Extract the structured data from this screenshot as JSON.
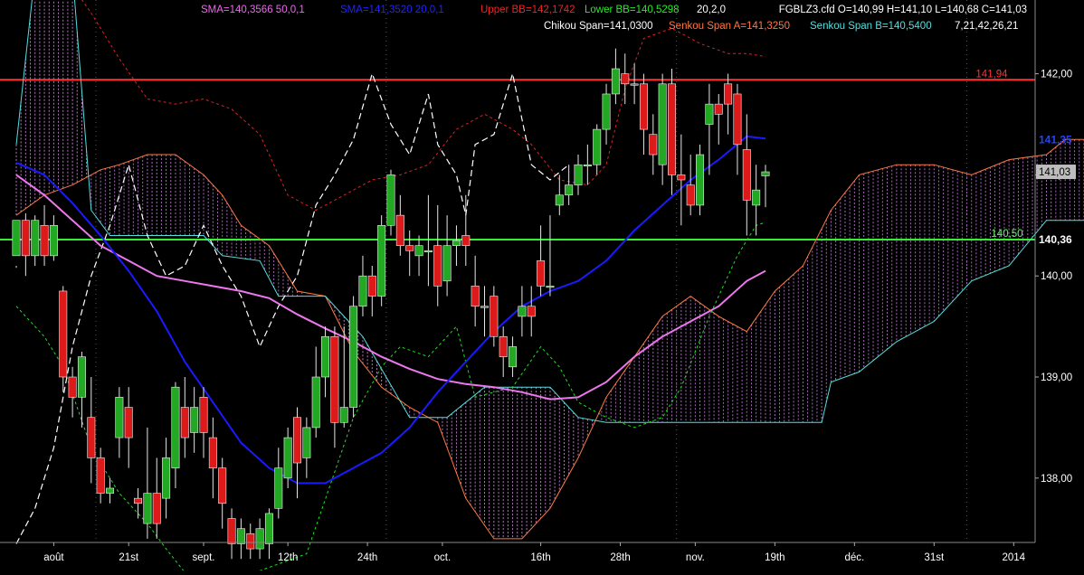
{
  "instrument_info": "FGBLZ3.cfd O=140,99 H=141,10 L=140,68 C=141,03",
  "indicators_row1": [
    {
      "id": "sma50",
      "text": "SMA=140,3566  50,0,1",
      "color": "#ee66ee"
    },
    {
      "id": "sma20",
      "text": "SMA=141,3520  20,0,1",
      "color": "#2222ff"
    },
    {
      "id": "bb_upper",
      "text": "Upper BB=142,1742",
      "color": "#ee2222"
    },
    {
      "id": "bb_lower",
      "text": "Lower BB=140,5298",
      "color": "#22ee22"
    },
    {
      "id": "bb_params",
      "text": "20,2,0",
      "color": "#ffffff"
    }
  ],
  "indicators_row2": [
    {
      "id": "chikou",
      "text": "Chikou Span=141,0300",
      "color": "#ffffff"
    },
    {
      "id": "senkou_a",
      "text": "Senkou Span A=141,3250",
      "color": "#ff7744"
    },
    {
      "id": "senkou_b",
      "text": "Senkou Span B=140,5400",
      "color": "#55dddd"
    },
    {
      "id": "ichimoku_params",
      "text": "7,21,42,26,21",
      "color": "#ffffff"
    }
  ],
  "price_labels": {
    "red_line": "141,94",
    "sma20": "141,35",
    "last": "141,03",
    "green_line": "140,36",
    "senkou_b": "140,50"
  },
  "chart_data": {
    "type": "candlestick",
    "ylim": [
      137.25,
      142.45
    ],
    "y_ticks": [
      "142,00",
      "141,00",
      "140,00",
      "139,00",
      "138,00"
    ],
    "x_ticks": [
      "août",
      "21st",
      "sept.",
      "12th",
      "24th",
      "oct.",
      "16th",
      "28th",
      "nov.",
      "19th",
      "déc.",
      "31st",
      "2014"
    ],
    "horizontal_lines": [
      {
        "value": 141.94,
        "color": "#ff3333"
      },
      {
        "value": 140.36,
        "color": "#33ee33"
      }
    ],
    "candles": [
      [
        0,
        140.2,
        140.55,
        140.1,
        140.08
      ],
      [
        1,
        140.55,
        140.2,
        140.62,
        140.0
      ],
      [
        2,
        140.2,
        140.55,
        140.6,
        140.1
      ],
      [
        3,
        140.5,
        140.2,
        140.7,
        140.1
      ],
      [
        4,
        140.2,
        140.5,
        140.6,
        140.15
      ],
      [
        5,
        139.85,
        139.0,
        139.9,
        138.85
      ],
      [
        6,
        139.0,
        138.8,
        139.1,
        138.6
      ],
      [
        7,
        138.8,
        139.2,
        139.25,
        138.5
      ],
      [
        8,
        138.6,
        138.2,
        139.0,
        137.95
      ],
      [
        9,
        138.2,
        137.85,
        138.3,
        137.75
      ],
      [
        10,
        137.85,
        137.9,
        138.0,
        137.75
      ],
      [
        11,
        138.4,
        138.8,
        138.9,
        138.2
      ],
      [
        12,
        138.7,
        138.4,
        138.9,
        138.1
      ],
      [
        13,
        137.8,
        137.75,
        137.9,
        137.6
      ],
      [
        14,
        137.55,
        137.85,
        138.5,
        137.4
      ],
      [
        15,
        137.85,
        137.55,
        138.2,
        137.4
      ],
      [
        16,
        137.8,
        138.2,
        138.4,
        137.6
      ],
      [
        17,
        138.1,
        138.9,
        138.95,
        137.9
      ],
      [
        18,
        138.7,
        138.4,
        139.0,
        138.2
      ],
      [
        19,
        138.45,
        138.7,
        138.9,
        138.25
      ],
      [
        20,
        138.8,
        138.45,
        138.9,
        138.2
      ],
      [
        21,
        138.4,
        138.1,
        138.6,
        137.8
      ],
      [
        22,
        138.1,
        137.75,
        138.2,
        137.5
      ],
      [
        23,
        137.6,
        137.35,
        137.7,
        137.2
      ],
      [
        24,
        137.35,
        137.5,
        137.6,
        137.2
      ],
      [
        25,
        137.45,
        137.3,
        137.55,
        137.2
      ],
      [
        26,
        137.3,
        137.5,
        137.6,
        137.2
      ],
      [
        27,
        137.35,
        137.65,
        137.7,
        137.2
      ],
      [
        28,
        137.7,
        138.1,
        138.3,
        137.6
      ],
      [
        29,
        138.0,
        138.4,
        138.5,
        137.9
      ],
      [
        30,
        138.6,
        138.15,
        138.7,
        137.8
      ],
      [
        31,
        138.2,
        138.5,
        138.6,
        138.0
      ],
      [
        32,
        138.5,
        139.0,
        139.3,
        138.4
      ],
      [
        33,
        139.0,
        139.4,
        139.5,
        138.8
      ],
      [
        34,
        139.4,
        138.55,
        139.5,
        138.3
      ],
      [
        35,
        138.55,
        138.7,
        139.5,
        138.5
      ],
      [
        36,
        138.7,
        139.7,
        139.8,
        138.6
      ],
      [
        37,
        139.7,
        140.0,
        140.2,
        139.6
      ],
      [
        38,
        140.0,
        139.8,
        140.1,
        139.6
      ],
      [
        39,
        139.8,
        140.5,
        140.6,
        139.7
      ],
      [
        40,
        140.5,
        141.0,
        141.05,
        140.4
      ],
      [
        41,
        140.6,
        140.3,
        140.8,
        140.2
      ],
      [
        42,
        140.3,
        140.25,
        140.45,
        140.0
      ],
      [
        43,
        140.2,
        140.3,
        140.4,
        140.0
      ],
      [
        44,
        140.25,
        140.25,
        140.8,
        139.9
      ],
      [
        45,
        140.3,
        139.9,
        140.7,
        139.7
      ],
      [
        46,
        139.95,
        140.3,
        140.6,
        139.8
      ],
      [
        47,
        140.3,
        140.35,
        140.5,
        140.1
      ],
      [
        48,
        140.4,
        140.3,
        140.8,
        140.1
      ],
      [
        49,
        139.9,
        139.7,
        140.2,
        139.5
      ],
      [
        50,
        139.7,
        139.7,
        139.9,
        139.4
      ],
      [
        51,
        139.8,
        139.4,
        139.9,
        139.3
      ],
      [
        52,
        139.4,
        139.2,
        139.5,
        139.0
      ],
      [
        53,
        139.1,
        139.3,
        139.4,
        139.0
      ],
      [
        54,
        139.6,
        139.7,
        139.9,
        139.4
      ],
      [
        55,
        139.7,
        139.6,
        139.9,
        139.4
      ],
      [
        56,
        140.15,
        139.9,
        140.5,
        139.8
      ],
      [
        57,
        139.9,
        139.9,
        140.6,
        139.8
      ],
      [
        58,
        140.7,
        140.8,
        141.0,
        140.6
      ],
      [
        59,
        140.8,
        140.9,
        141.1,
        140.7
      ],
      [
        60,
        140.9,
        141.1,
        141.2,
        140.8
      ],
      [
        61,
        141.1,
        141.1,
        141.3,
        140.9
      ],
      [
        62,
        141.1,
        141.45,
        141.5,
        141.0
      ],
      [
        63,
        141.45,
        141.8,
        141.9,
        141.3
      ],
      [
        64,
        141.8,
        142.05,
        142.25,
        141.7
      ],
      [
        65,
        142.0,
        141.9,
        142.2,
        141.7
      ],
      [
        66,
        141.9,
        141.9,
        142.1,
        141.7
      ],
      [
        67,
        141.9,
        141.45,
        142.0,
        141.2
      ],
      [
        68,
        141.4,
        141.2,
        141.6,
        141.0
      ],
      [
        69,
        141.1,
        141.9,
        142.0,
        140.9
      ],
      [
        70,
        141.9,
        141.0,
        142.05,
        140.8
      ],
      [
        71,
        141.0,
        140.95,
        141.4,
        140.5
      ],
      [
        72,
        140.9,
        140.7,
        141.2,
        140.6
      ],
      [
        73,
        140.7,
        141.2,
        141.3,
        140.6
      ],
      [
        74,
        141.5,
        141.7,
        141.9,
        141.0
      ],
      [
        75,
        141.7,
        141.6,
        141.8,
        141.3
      ],
      [
        76,
        141.9,
        141.7,
        142.0,
        141.4
      ],
      [
        77,
        141.8,
        141.3,
        141.9,
        141.0
      ],
      [
        78,
        141.25,
        140.75,
        141.6,
        140.4
      ],
      [
        79,
        140.7,
        140.85,
        141.1,
        140.4
      ],
      [
        80,
        140.99,
        141.03,
        141.1,
        140.68
      ]
    ],
    "sma20": [
      [
        0,
        141.12
      ],
      [
        3,
        141.0
      ],
      [
        6,
        140.72
      ],
      [
        9,
        140.4
      ],
      [
        12,
        140.05
      ],
      [
        15,
        139.65
      ],
      [
        18,
        139.15
      ],
      [
        21,
        138.75
      ],
      [
        24,
        138.35
      ],
      [
        27,
        138.1
      ],
      [
        30,
        137.95
      ],
      [
        33,
        137.95
      ],
      [
        36,
        138.1
      ],
      [
        39,
        138.25
      ],
      [
        42,
        138.5
      ],
      [
        45,
        138.85
      ],
      [
        48,
        139.15
      ],
      [
        51,
        139.45
      ],
      [
        54,
        139.7
      ],
      [
        57,
        139.85
      ],
      [
        60,
        139.95
      ],
      [
        63,
        140.15
      ],
      [
        66,
        140.45
      ],
      [
        69,
        140.7
      ],
      [
        72,
        140.95
      ],
      [
        75,
        141.15
      ],
      [
        78,
        141.38
      ],
      [
        80,
        141.36
      ]
    ],
    "sma50": [
      [
        0,
        141.0
      ],
      [
        3,
        140.8
      ],
      [
        6,
        140.55
      ],
      [
        9,
        140.3
      ],
      [
        12,
        140.15
      ],
      [
        15,
        140.0
      ],
      [
        18,
        139.95
      ],
      [
        21,
        139.9
      ],
      [
        24,
        139.85
      ],
      [
        27,
        139.78
      ],
      [
        30,
        139.62
      ],
      [
        33,
        139.48
      ],
      [
        36,
        139.35
      ],
      [
        39,
        139.2
      ],
      [
        42,
        139.08
      ],
      [
        45,
        138.98
      ],
      [
        48,
        138.93
      ],
      [
        51,
        138.9
      ],
      [
        54,
        138.85
      ],
      [
        57,
        138.78
      ],
      [
        60,
        138.8
      ],
      [
        63,
        138.95
      ],
      [
        66,
        139.2
      ],
      [
        69,
        139.4
      ],
      [
        72,
        139.55
      ],
      [
        75,
        139.7
      ],
      [
        78,
        139.95
      ],
      [
        80,
        140.05
      ]
    ],
    "bb_upper": [
      [
        5,
        143.0
      ],
      [
        8,
        142.6
      ],
      [
        11,
        142.15
      ],
      [
        14,
        141.75
      ],
      [
        17,
        141.7
      ],
      [
        20,
        141.75
      ],
      [
        23,
        141.65
      ],
      [
        26,
        141.4
      ],
      [
        29,
        140.8
      ],
      [
        32,
        140.65
      ],
      [
        35,
        140.8
      ],
      [
        38,
        140.95
      ],
      [
        41,
        141.0
      ],
      [
        44,
        141.1
      ],
      [
        47,
        141.45
      ],
      [
        50,
        141.6
      ],
      [
        53,
        141.45
      ],
      [
        55,
        141.3
      ],
      [
        58,
        140.95
      ],
      [
        61,
        140.9
      ],
      [
        63,
        141.1
      ],
      [
        65,
        141.85
      ],
      [
        67,
        142.35
      ],
      [
        70,
        142.45
      ],
      [
        73,
        142.3
      ],
      [
        76,
        142.2
      ],
      [
        78,
        142.2
      ],
      [
        80,
        142.17
      ]
    ],
    "bb_lower": [
      [
        0,
        139.7
      ],
      [
        3,
        139.4
      ],
      [
        5,
        139.1
      ],
      [
        8,
        138.3
      ],
      [
        11,
        137.85
      ],
      [
        14,
        137.55
      ],
      [
        16,
        137.3
      ],
      [
        19,
        136.95
      ],
      [
        22,
        136.95
      ],
      [
        25,
        137.05
      ],
      [
        31,
        137.25
      ],
      [
        36,
        138.6
      ],
      [
        39,
        139.1
      ],
      [
        41,
        139.3
      ],
      [
        44,
        139.2
      ],
      [
        47,
        139.5
      ],
      [
        49,
        138.8
      ],
      [
        53,
        138.9
      ],
      [
        56,
        139.3
      ],
      [
        58,
        139.1
      ],
      [
        60,
        138.75
      ],
      [
        63,
        138.6
      ],
      [
        66,
        138.5
      ],
      [
        69,
        138.6
      ],
      [
        71,
        138.9
      ],
      [
        74,
        139.6
      ],
      [
        77,
        140.2
      ],
      [
        79,
        140.5
      ],
      [
        80,
        140.53
      ]
    ],
    "senkou_a": [
      [
        0,
        140.6
      ],
      [
        3,
        140.8
      ],
      [
        6,
        140.9
      ],
      [
        9,
        141.05
      ],
      [
        11,
        141.1
      ],
      [
        14,
        141.2
      ],
      [
        17,
        141.2
      ],
      [
        20,
        141.0
      ],
      [
        22,
        140.8
      ],
      [
        24,
        140.5
      ],
      [
        27,
        140.3
      ],
      [
        30,
        139.85
      ],
      [
        33,
        139.8
      ],
      [
        36,
        139.25
      ],
      [
        39,
        138.9
      ],
      [
        42,
        138.7
      ],
      [
        45,
        138.55
      ],
      [
        48,
        137.8
      ],
      [
        51,
        137.4
      ],
      [
        54,
        137.4
      ],
      [
        57,
        137.7
      ],
      [
        60,
        138.2
      ],
      [
        63,
        138.8
      ],
      [
        66,
        139.2
      ],
      [
        69,
        139.6
      ],
      [
        72,
        139.8
      ],
      [
        75,
        139.6
      ],
      [
        78,
        139.45
      ],
      [
        81,
        139.85
      ],
      [
        84,
        140.1
      ],
      [
        87,
        140.65
      ],
      [
        90,
        141.0
      ],
      [
        94,
        141.1
      ],
      [
        98,
        141.1
      ],
      [
        102,
        141.0
      ],
      [
        106,
        141.15
      ],
      [
        110,
        141.2
      ],
      [
        112,
        141.35
      ],
      [
        114,
        141.35
      ]
    ],
    "senkou_b": [
      [
        0,
        141.3
      ],
      [
        2,
        143.0
      ],
      [
        6,
        143.0
      ],
      [
        8,
        140.65
      ],
      [
        10,
        140.4
      ],
      [
        14,
        140.4
      ],
      [
        20,
        140.4
      ],
      [
        22,
        140.2
      ],
      [
        26,
        140.15
      ],
      [
        28,
        139.8
      ],
      [
        33,
        139.8
      ],
      [
        37,
        139.4
      ],
      [
        42,
        138.6
      ],
      [
        46,
        138.6
      ],
      [
        50,
        138.9
      ],
      [
        54,
        138.9
      ],
      [
        57,
        138.9
      ],
      [
        60,
        138.6
      ],
      [
        63,
        138.55
      ],
      [
        67,
        138.55
      ],
      [
        72,
        138.55
      ],
      [
        75,
        138.55
      ],
      [
        81,
        138.55
      ],
      [
        86,
        138.55
      ],
      [
        87,
        138.95
      ],
      [
        90,
        139.05
      ],
      [
        94,
        139.35
      ],
      [
        98,
        139.55
      ],
      [
        102,
        139.95
      ],
      [
        106,
        140.1
      ],
      [
        110,
        140.55
      ],
      [
        114,
        140.55
      ]
    ],
    "chikou": [
      [
        0,
        137.35
      ],
      [
        2,
        137.7
      ],
      [
        4,
        138.3
      ],
      [
        6,
        139.3
      ],
      [
        8,
        140.0
      ],
      [
        10,
        140.5
      ],
      [
        12,
        141.1
      ],
      [
        14,
        140.4
      ],
      [
        16,
        140.0
      ],
      [
        18,
        140.1
      ],
      [
        20,
        140.5
      ],
      [
        22,
        140.1
      ],
      [
        24,
        139.8
      ],
      [
        26,
        139.3
      ],
      [
        28,
        139.7
      ],
      [
        30,
        140.0
      ],
      [
        32,
        140.7
      ],
      [
        34,
        141.0
      ],
      [
        36,
        141.35
      ],
      [
        38,
        142.0
      ],
      [
        40,
        141.5
      ],
      [
        42,
        141.2
      ],
      [
        44,
        141.8
      ],
      [
        45,
        141.3
      ],
      [
        47,
        141.0
      ],
      [
        48,
        140.6
      ],
      [
        49,
        141.3
      ],
      [
        51,
        141.4
      ],
      [
        53,
        142.0
      ],
      [
        55,
        141.1
      ],
      [
        57,
        140.95
      ],
      [
        59,
        141.1
      ]
    ]
  }
}
